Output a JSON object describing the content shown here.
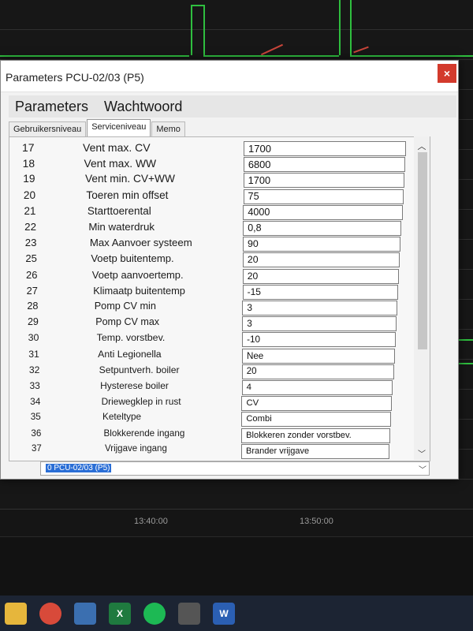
{
  "dialog": {
    "title": "Parameters PCU-02/03 (P5)",
    "close_glyph": "×",
    "menu": [
      "Parameters",
      "Wachtwoord"
    ],
    "tabs": [
      "Gebruikersniveau",
      "Serviceniveau",
      "Memo"
    ],
    "active_tab": "Serviceniveau",
    "status_value": "0 PCU-02/03 (P5)"
  },
  "params": [
    {
      "num": "17",
      "label": "Vent max. CV",
      "value": "1700"
    },
    {
      "num": "18",
      "label": "Vent max. WW",
      "value": "6800"
    },
    {
      "num": "19",
      "label": "Vent min. CV+WW",
      "value": "1700"
    },
    {
      "num": "20",
      "label": "Toeren min offset",
      "value": "75"
    },
    {
      "num": "21",
      "label": "Starttoerental",
      "value": "4000"
    },
    {
      "num": "22",
      "label": "Min waterdruk",
      "value": "0,8"
    },
    {
      "num": "23",
      "label": "Max Aanvoer systeem",
      "value": "90"
    },
    {
      "num": "25",
      "label": "Voetp buitentemp.",
      "value": "20"
    },
    {
      "num": "26",
      "label": "Voetp aanvoertemp.",
      "value": "20"
    },
    {
      "num": "27",
      "label": "Klimaatp buitentemp",
      "value": "-15"
    },
    {
      "num": "28",
      "label": "Pomp CV min",
      "value": "3"
    },
    {
      "num": "29",
      "label": "Pomp CV max",
      "value": "3"
    },
    {
      "num": "30",
      "label": "Temp. vorstbev.",
      "value": "-10"
    },
    {
      "num": "31",
      "label": "Anti Legionella",
      "value": "Nee"
    },
    {
      "num": "32",
      "label": "Setpuntverh. boiler",
      "value": "20"
    },
    {
      "num": "33",
      "label": "Hysterese boiler",
      "value": "4"
    },
    {
      "num": "34",
      "label": "Driewegklep in rust",
      "value": "CV"
    },
    {
      "num": "35",
      "label": "Keteltype",
      "value": "Combi"
    },
    {
      "num": "36",
      "label": "Blokkerende ingang",
      "value": "Blokkeren zonder vorstbev."
    },
    {
      "num": "37",
      "label": "Vrijgave ingang",
      "value": "Brander vrijgave"
    }
  ],
  "background": {
    "time_labels": [
      "13:40:00",
      "13:50:00"
    ]
  },
  "colors": {
    "trace_green": "#2fbf3f",
    "trace_red": "#c8453a",
    "trace_yellow": "#d6c22a",
    "close_red": "#d33a2c"
  },
  "taskbar_icons": [
    "file-explorer-icon",
    "chrome-icon",
    "calculator-icon",
    "excel-icon",
    "spotify-icon",
    "app-icon",
    "word-icon"
  ]
}
